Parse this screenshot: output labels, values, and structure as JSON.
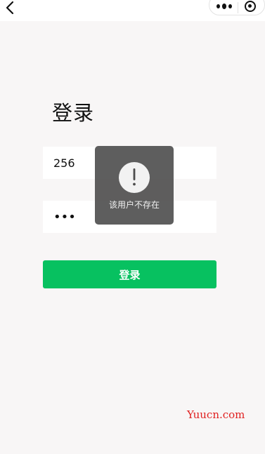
{
  "navbar": {
    "back_icon": "chevron-left-icon",
    "menu_icon": "more-dots-icon",
    "close_icon": "target-close-icon"
  },
  "page": {
    "title": "登录"
  },
  "form": {
    "username_value": "256",
    "password_value": "•••",
    "login_label": "登录"
  },
  "toast": {
    "icon": "exclamation-icon",
    "message": "该用户不存在"
  },
  "watermark": {
    "text": "Yuucn.com"
  },
  "colors": {
    "primary": "#07c160",
    "background": "#f8f6f6",
    "toast_bg": "#4c4c4c",
    "watermark": "#e02020"
  }
}
